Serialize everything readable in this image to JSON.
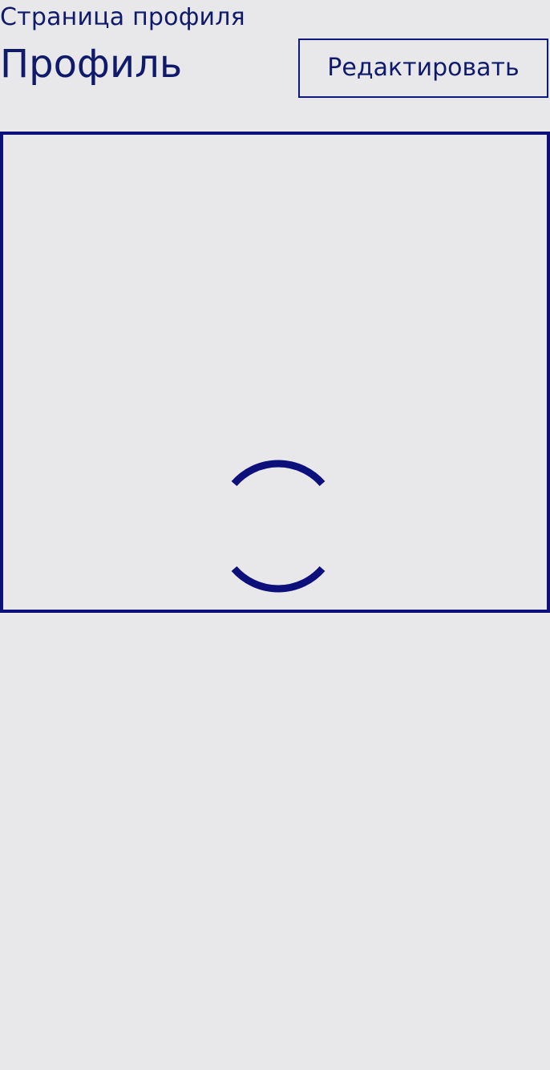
{
  "header": {
    "subtitle": "Страница профиля",
    "title": "Профиль",
    "edit_label": "Редактировать"
  },
  "content": {
    "loading_icon": "loading-spinner-icon"
  },
  "colors": {
    "background": "#e8e8ea",
    "accent": "#0d0f7a",
    "text": "#0f1a6b"
  }
}
